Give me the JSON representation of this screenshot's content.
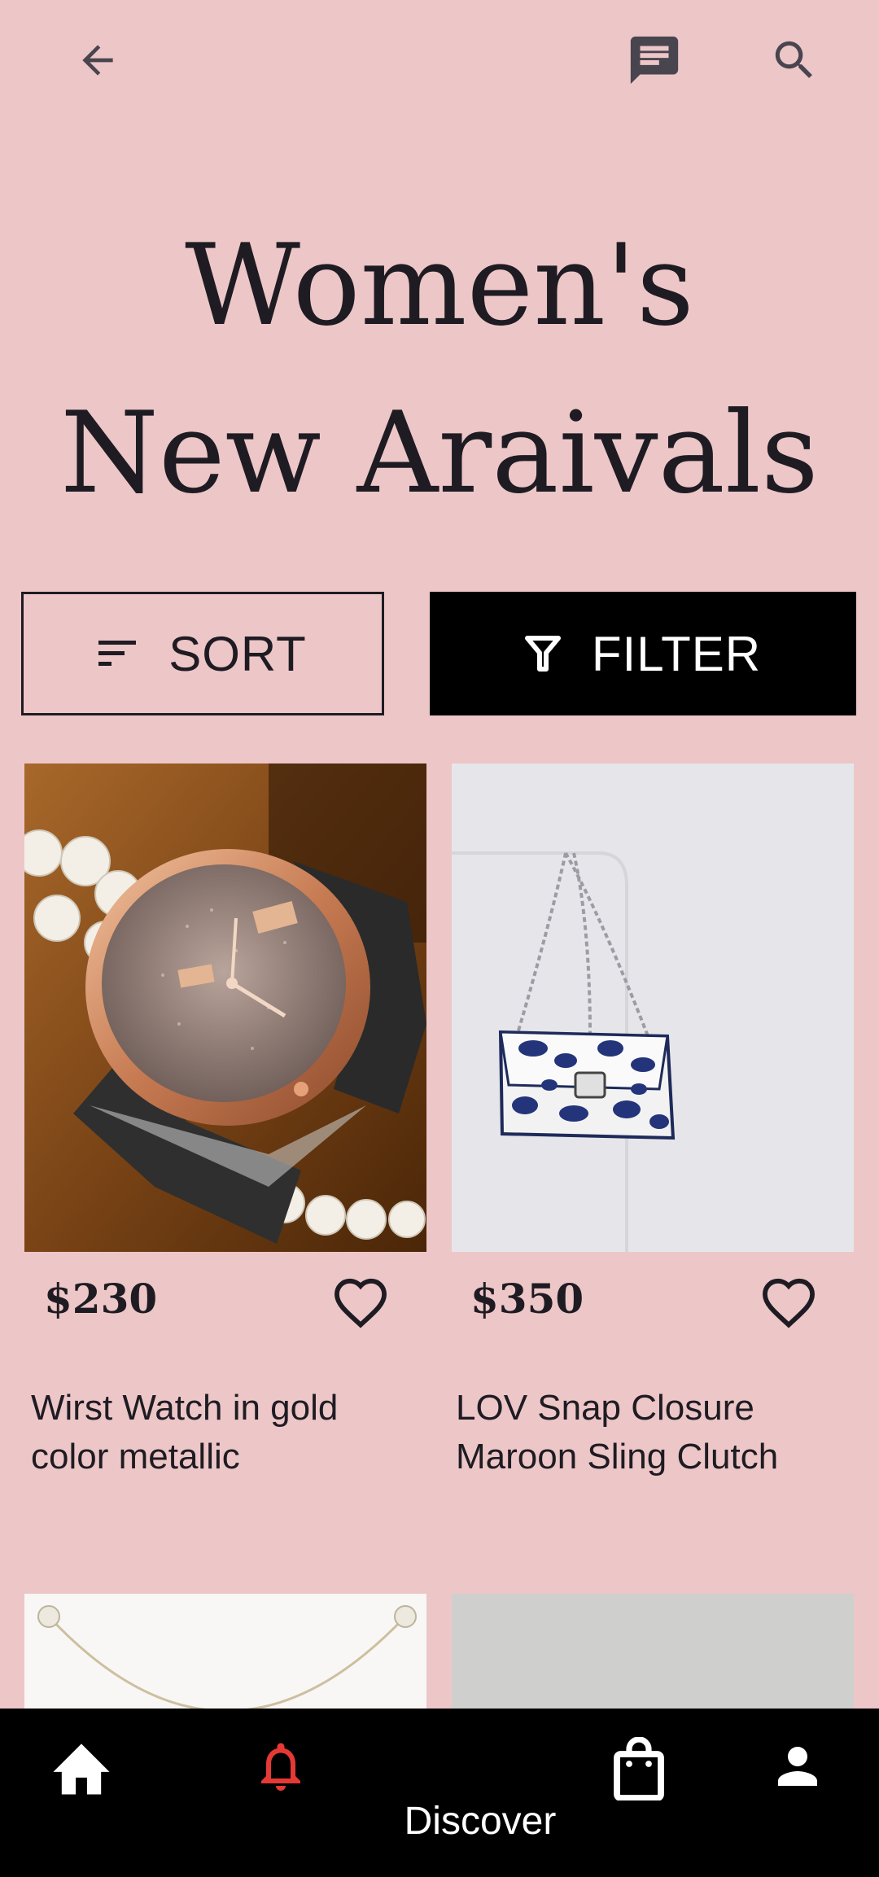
{
  "header": {
    "back_icon": "arrow-left-icon",
    "chat_icon": "chat-icon",
    "search_icon": "search-icon"
  },
  "page": {
    "title_line1": "Women's",
    "title_line2": "New Araivals"
  },
  "toolbar": {
    "sort_label": "SORT",
    "filter_label": "FILTER",
    "sort_icon": "sort-icon",
    "filter_icon": "funnel-icon"
  },
  "products": [
    {
      "price": "$230",
      "name_line1": "Wirst Watch in gold",
      "name_line2": "color metallic",
      "favorite": false
    },
    {
      "price": "$350",
      "name_line1": "LOV Snap Closure",
      "name_line2": "Maroon Sling Clutch",
      "favorite": false
    }
  ],
  "bottom_nav": {
    "active_label": "Discover",
    "items": [
      "home-icon",
      "bell-icon",
      "shopping-bag-icon",
      "person-icon"
    ]
  },
  "colors": {
    "background": "#EDC6C8",
    "text": "#1E1C22",
    "accent_bell": "#E53935",
    "nav": "#000000"
  }
}
